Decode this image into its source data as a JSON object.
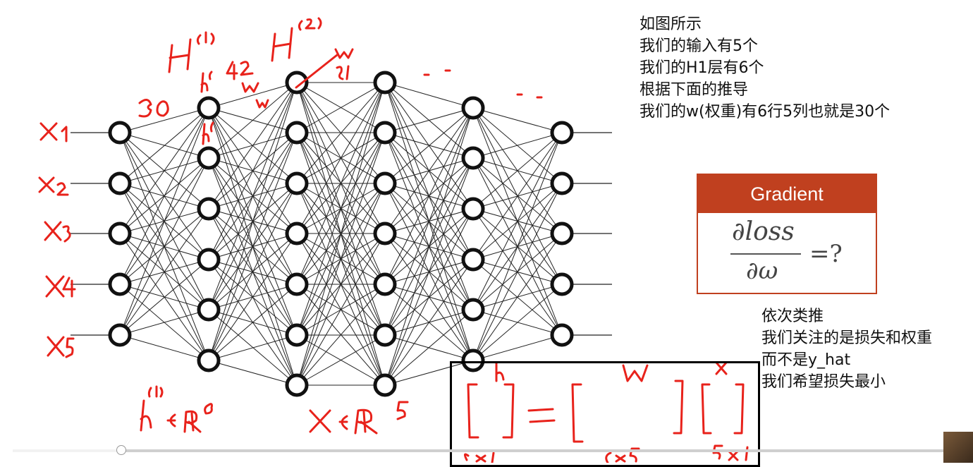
{
  "notes_top": {
    "lines": [
      "如图所示",
      "我们的输入有5个",
      "我们的H1层有6个",
      "根据下面的推导",
      "我们的w(权重)有6行5列也就是30个"
    ]
  },
  "notes_bottom": {
    "lines": [
      "依次类推",
      "我们关注的是损失和权重",
      "而不是y_hat",
      "我们希望损失最小"
    ]
  },
  "gradient_card": {
    "header": "Gradient",
    "numerator": "∂loss",
    "denominator": "∂ω",
    "equals": "=?",
    "color": "#c0401f"
  },
  "network": {
    "layer_node_counts": [
      5,
      6,
      7,
      7,
      6,
      5
    ],
    "node_color": "#111111"
  },
  "handwriting_color": "#e8221b",
  "video_player": {
    "progress_fraction": 0.115
  }
}
